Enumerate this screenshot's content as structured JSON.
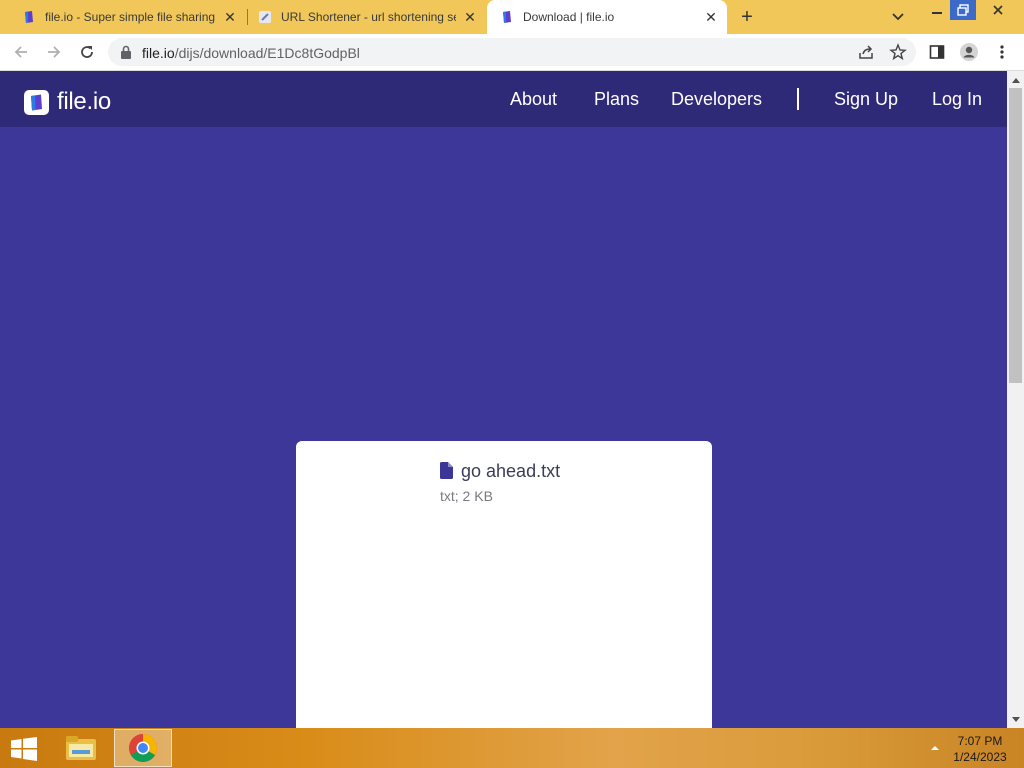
{
  "browser": {
    "tabs": [
      {
        "title": "file.io - Super simple file sharing",
        "active": false
      },
      {
        "title": "URL Shortener - url shortening service",
        "active": false
      },
      {
        "title": "Download | file.io",
        "active": true
      }
    ],
    "url_host": "file.io",
    "url_path": "/dijs/download/E1Dc8tGodpBl"
  },
  "site": {
    "logo_text": "file.io",
    "nav": {
      "about": "About",
      "plans": "Plans",
      "developers": "Developers",
      "signup": "Sign Up",
      "login": "Log In"
    }
  },
  "file": {
    "name": "go ahead.txt",
    "meta": "txt; 2 KB"
  },
  "taskbar": {
    "time": "7:07 PM",
    "date": "1/24/2023"
  },
  "colors": {
    "page_background": "#3c3799",
    "site_header": "#2f2a78",
    "tab_strip": "#f1c75a",
    "file_icon": "#3a3596"
  }
}
